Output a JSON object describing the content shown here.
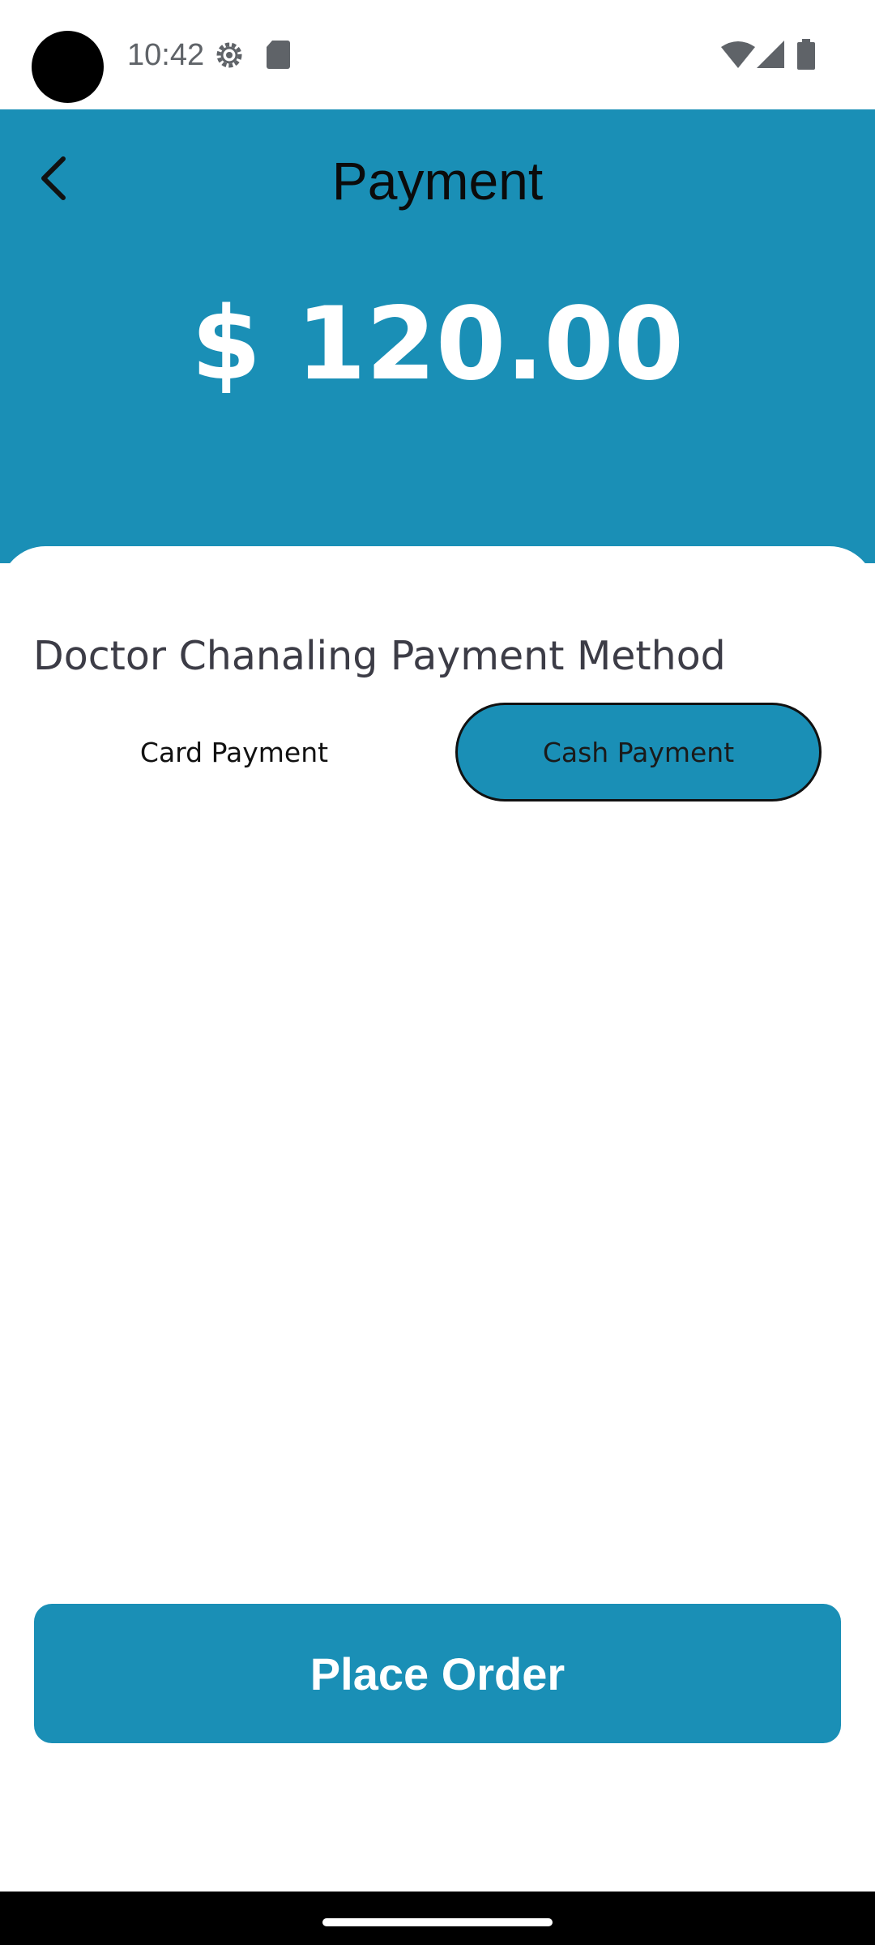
{
  "status_bar": {
    "time": "10:42",
    "icons": [
      "settings-gear-icon",
      "sd-card-icon",
      "wifi-icon",
      "cell-signal-icon",
      "battery-icon"
    ]
  },
  "header": {
    "back_icon": "chevron-left-icon",
    "title": "Payment",
    "amount": "$ 120.00",
    "background_color": "#1a8fb6"
  },
  "payment": {
    "section_title": "Doctor Chanaling Payment Method",
    "options": [
      {
        "label": "Card Payment",
        "selected": false
      },
      {
        "label": "Cash Payment",
        "selected": true
      }
    ]
  },
  "actions": {
    "place_order_label": "Place Order"
  },
  "colors": {
    "accent": "#1a8fb6"
  }
}
